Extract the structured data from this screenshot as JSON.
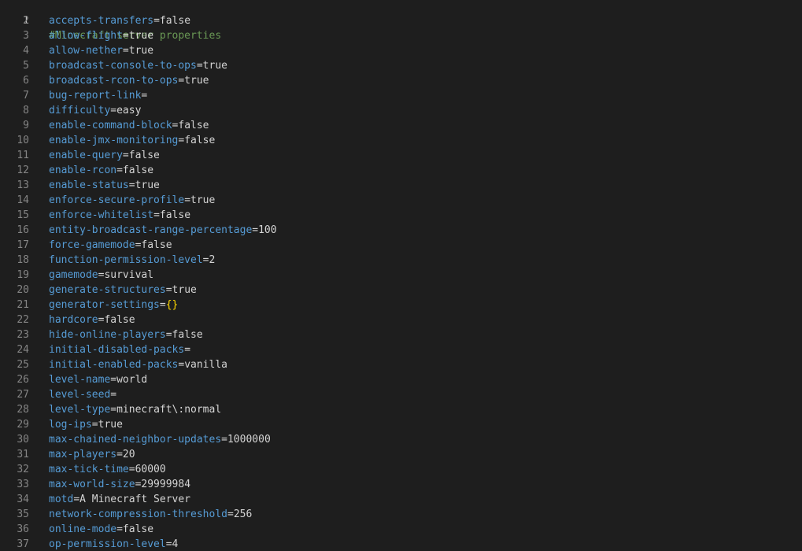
{
  "editor": {
    "comment_line": {
      "number": "1",
      "text": "#Minecraft server properties"
    },
    "properties": [
      {
        "number": "2",
        "key": "accepts-transfers",
        "value": "false"
      },
      {
        "number": "3",
        "key": "allow-flight",
        "value": "true"
      },
      {
        "number": "4",
        "key": "allow-nether",
        "value": "true"
      },
      {
        "number": "5",
        "key": "broadcast-console-to-ops",
        "value": "true"
      },
      {
        "number": "6",
        "key": "broadcast-rcon-to-ops",
        "value": "true"
      },
      {
        "number": "7",
        "key": "bug-report-link",
        "value": ""
      },
      {
        "number": "8",
        "key": "difficulty",
        "value": "easy"
      },
      {
        "number": "9",
        "key": "enable-command-block",
        "value": "false"
      },
      {
        "number": "10",
        "key": "enable-jmx-monitoring",
        "value": "false"
      },
      {
        "number": "11",
        "key": "enable-query",
        "value": "false"
      },
      {
        "number": "12",
        "key": "enable-rcon",
        "value": "false"
      },
      {
        "number": "13",
        "key": "enable-status",
        "value": "true"
      },
      {
        "number": "14",
        "key": "enforce-secure-profile",
        "value": "true"
      },
      {
        "number": "15",
        "key": "enforce-whitelist",
        "value": "false"
      },
      {
        "number": "16",
        "key": "entity-broadcast-range-percentage",
        "value": "100"
      },
      {
        "number": "17",
        "key": "force-gamemode",
        "value": "false"
      },
      {
        "number": "18",
        "key": "function-permission-level",
        "value": "2"
      },
      {
        "number": "19",
        "key": "gamemode",
        "value": "survival"
      },
      {
        "number": "20",
        "key": "generate-structures",
        "value": "true"
      },
      {
        "number": "21",
        "key": "generator-settings",
        "value": "{}"
      },
      {
        "number": "22",
        "key": "hardcore",
        "value": "false"
      },
      {
        "number": "23",
        "key": "hide-online-players",
        "value": "false"
      },
      {
        "number": "24",
        "key": "initial-disabled-packs",
        "value": ""
      },
      {
        "number": "25",
        "key": "initial-enabled-packs",
        "value": "vanilla"
      },
      {
        "number": "26",
        "key": "level-name",
        "value": "world"
      },
      {
        "number": "27",
        "key": "level-seed",
        "value": ""
      },
      {
        "number": "28",
        "key": "level-type",
        "value": "minecraft\\:normal"
      },
      {
        "number": "29",
        "key": "log-ips",
        "value": "true"
      },
      {
        "number": "30",
        "key": "max-chained-neighbor-updates",
        "value": "1000000"
      },
      {
        "number": "31",
        "key": "max-players",
        "value": "20"
      },
      {
        "number": "32",
        "key": "max-tick-time",
        "value": "60000"
      },
      {
        "number": "33",
        "key": "max-world-size",
        "value": "29999984"
      },
      {
        "number": "34",
        "key": "motd",
        "value": "A Minecraft Server"
      },
      {
        "number": "35",
        "key": "network-compression-threshold",
        "value": "256"
      },
      {
        "number": "36",
        "key": "online-mode",
        "value": "false"
      },
      {
        "number": "37",
        "key": "op-permission-level",
        "value": "4"
      }
    ],
    "separator": "=",
    "colors": {
      "background": "#1e1e1e",
      "key": "#569cd6",
      "value": "#d4d4d4",
      "comment": "#6a9955",
      "brace": "#ffd700",
      "line_number": "#858585",
      "active_line_number": "#c6c6c6"
    }
  }
}
